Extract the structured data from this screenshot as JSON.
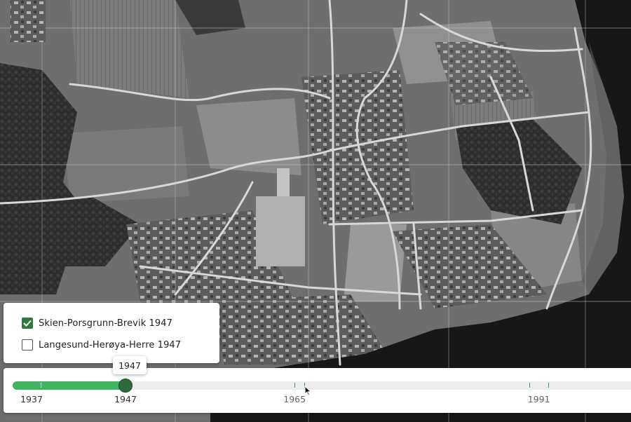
{
  "map": {
    "type": "aerial-photo",
    "colors": {
      "land": "#6e6e6e",
      "field_light": "#8f8f8f",
      "forest": "#2e2e2e",
      "road": "#d6d6d6",
      "water": "#161616"
    }
  },
  "layers": [
    {
      "label": "Skien-Porsgrunn-Brevik 1947",
      "checked": true
    },
    {
      "label": "Langesund-Herøya-Herre 1947",
      "checked": false
    }
  ],
  "timeline": {
    "selected_year": "1947",
    "tooltip": "1947",
    "year_labels": [
      "1937",
      "1947",
      "1965",
      "1991"
    ],
    "tick_years": [
      1938,
      1965,
      1966,
      1990,
      1992
    ],
    "range": [
      1936,
      2020
    ],
    "accent": "#3fb55f",
    "thumb_color": "#2d6b3c"
  }
}
